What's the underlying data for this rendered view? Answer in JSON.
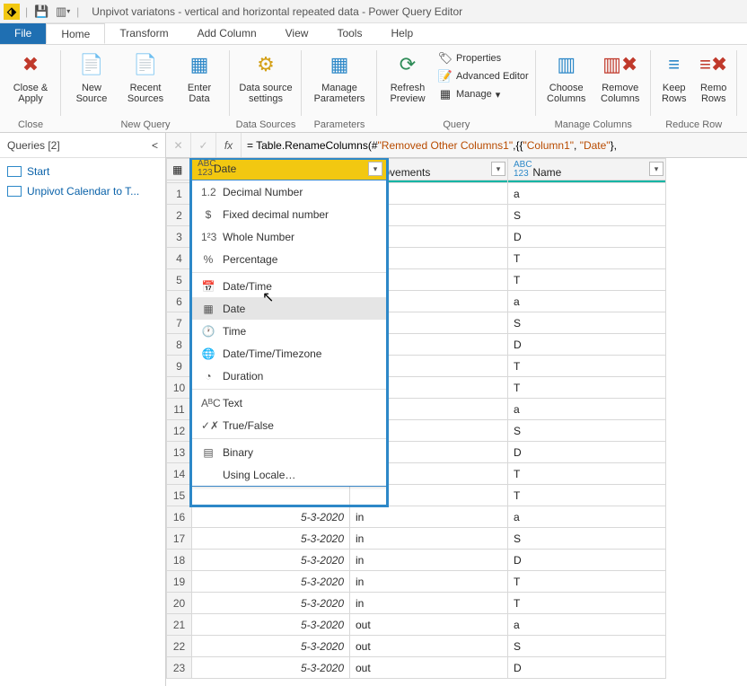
{
  "titlebar": {
    "app": "Unpivot variatons  - vertical and horizontal repeated data - Power Query Editor"
  },
  "tabs": {
    "file": "File",
    "home": "Home",
    "transform": "Transform",
    "addcolumn": "Add Column",
    "view": "View",
    "tools": "Tools",
    "help": "Help"
  },
  "ribbon": {
    "close_apply": "Close &\nApply",
    "close_group": "Close",
    "new_source": "New\nSource",
    "recent_sources": "Recent\nSources",
    "enter_data": "Enter\nData",
    "new_query_group": "New Query",
    "data_source_settings": "Data source\nsettings",
    "data_sources_group": "Data Sources",
    "manage_parameters": "Manage\nParameters",
    "parameters_group": "Parameters",
    "refresh_preview": "Refresh\nPreview",
    "properties": "Properties",
    "advanced_editor": "Advanced Editor",
    "manage": "Manage",
    "query_group": "Query",
    "choose_columns": "Choose\nColumns",
    "remove_columns": "Remove\nColumns",
    "manage_columns_group": "Manage Columns",
    "keep_rows": "Keep\nRows",
    "remove_rows": "Remo\nRows",
    "reduce_rows_group": "Reduce Row"
  },
  "queries": {
    "header": "Queries [2]",
    "items": [
      {
        "label": "Start"
      },
      {
        "label": "Unpivot Calendar to T..."
      }
    ]
  },
  "formula": {
    "prefix": "= Table.RenameColumns(#",
    "arg1": "\"Removed Other Columns1\"",
    "mid": ",{{",
    "col1": "\"Column1\"",
    "comma": ", ",
    "col2": "\"Date\"",
    "suffix": "},"
  },
  "columns": {
    "date": "Date",
    "movements": "Movements",
    "name": "Name",
    "type_abc123": "ABC\n123"
  },
  "type_menu": {
    "header": "Date",
    "items": [
      {
        "icon": "1.2",
        "label": "Decimal Number"
      },
      {
        "icon": "$",
        "label": "Fixed decimal number"
      },
      {
        "icon": "1²3",
        "label": "Whole Number"
      },
      {
        "icon": "%",
        "label": "Percentage"
      },
      {
        "sep": true
      },
      {
        "icon": "📅",
        "label": "Date/Time"
      },
      {
        "icon": "▦",
        "label": "Date",
        "hover": true
      },
      {
        "icon": "🕐",
        "label": "Time"
      },
      {
        "icon": "🌐",
        "label": "Date/Time/Timezone"
      },
      {
        "icon": "◔",
        "label": "Duration"
      },
      {
        "sep": true
      },
      {
        "icon": "AᴮC",
        "label": "Text"
      },
      {
        "icon": "✓✗",
        "label": "True/False"
      },
      {
        "sep": true
      },
      {
        "icon": "▤",
        "label": "Binary"
      },
      {
        "icon": "",
        "label": "Using Locale…"
      }
    ]
  },
  "rows": [
    {
      "n": 1,
      "date": "",
      "mov": "",
      "name": "a"
    },
    {
      "n": 2,
      "date": "",
      "mov": "",
      "name": "S"
    },
    {
      "n": 3,
      "date": "",
      "mov": "",
      "name": "D"
    },
    {
      "n": 4,
      "date": "",
      "mov": "",
      "name": "T"
    },
    {
      "n": 5,
      "date": "",
      "mov": "",
      "name": "T"
    },
    {
      "n": 6,
      "date": "",
      "mov": "",
      "name": "a"
    },
    {
      "n": 7,
      "date": "",
      "mov": "",
      "name": "S"
    },
    {
      "n": 8,
      "date": "",
      "mov": "",
      "name": "D"
    },
    {
      "n": 9,
      "date": "",
      "mov": "",
      "name": "T"
    },
    {
      "n": 10,
      "date": "",
      "mov": "",
      "name": "T"
    },
    {
      "n": 11,
      "date": "",
      "mov": "",
      "name": "a"
    },
    {
      "n": 12,
      "date": "",
      "mov": "",
      "name": "S"
    },
    {
      "n": 13,
      "date": "",
      "mov": "",
      "name": "D"
    },
    {
      "n": 14,
      "date": "",
      "mov": "",
      "name": "T"
    },
    {
      "n": 15,
      "date": "",
      "mov": "",
      "name": "T"
    },
    {
      "n": 16,
      "date": "5-3-2020",
      "mov": "in",
      "name": "a"
    },
    {
      "n": 17,
      "date": "5-3-2020",
      "mov": "in",
      "name": "S"
    },
    {
      "n": 18,
      "date": "5-3-2020",
      "mov": "in",
      "name": "D"
    },
    {
      "n": 19,
      "date": "5-3-2020",
      "mov": "in",
      "name": "T"
    },
    {
      "n": 20,
      "date": "5-3-2020",
      "mov": "in",
      "name": "T"
    },
    {
      "n": 21,
      "date": "5-3-2020",
      "mov": "out",
      "name": "a"
    },
    {
      "n": 22,
      "date": "5-3-2020",
      "mov": "out",
      "name": "S"
    },
    {
      "n": 23,
      "date": "5-3-2020",
      "mov": "out",
      "name": "D"
    }
  ]
}
